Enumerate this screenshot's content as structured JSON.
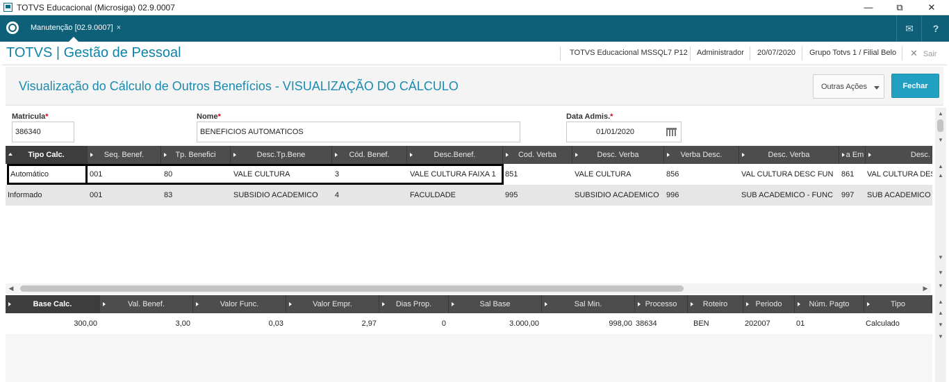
{
  "window": {
    "title": "TOTVS Educacional (Microsiga) 02.9.0007",
    "minimize": "—",
    "restore": "⧉",
    "close": "✕"
  },
  "appbar": {
    "tab_label": "Manutenção [02.9.0007]",
    "tab_close": "×",
    "mail_icon": "✉",
    "help_icon": "?"
  },
  "header": {
    "brand": "TOTVS | Gestão de Pessoal",
    "environment": "TOTVS Educacional MSSQL7 P12",
    "user": "Administrador",
    "date": "20/07/2020",
    "branch": "Grupo Totvs 1 / Filial Belo",
    "exit_label": "Sair",
    "exit_icon": "✕"
  },
  "page": {
    "title": "Visualização do Cálculo de Outros Benefícios - VISUALIZAÇÃO DO CÁLCULO",
    "other_actions_label": "Outras Ações",
    "close_label": "Fechar"
  },
  "form": {
    "matricula_label": "Matricula",
    "matricula_value": "386340",
    "nome_label": "Nome",
    "nome_value": "BENEFICIOS AUTOMATICOS",
    "data_label": "Data Admis.",
    "data_value": "01/01/2020",
    "required_mark": "*"
  },
  "grid1": {
    "columns": [
      "Tipo Calc.",
      "Seq. Benef.",
      "Tp. Benefici",
      "Desc.Tp.Bene",
      "Cód. Benef.",
      "Desc.Benef.",
      "Cod. Verba",
      "Desc. Verba",
      "Verba Desc.",
      "Desc. Verba",
      "a Em",
      "Desc."
    ],
    "rows": [
      [
        "Automático",
        "001",
        "80",
        "VALE CULTURA",
        "3",
        "VALE CULTURA FAIXA 1",
        "851",
        "VALE CULTURA",
        "856",
        "VAL CULTURA DESC FUN",
        "861",
        "VAL CULTURA DES"
      ],
      [
        "Informado",
        "001",
        "83",
        "SUBSIDIO ACADEMICO",
        "4",
        "FACULDADE",
        "995",
        "SUBSIDIO ACADEMICO",
        "996",
        "SUB ACADEMICO - FUNC",
        "997",
        "SUB ACADEMICO -"
      ]
    ]
  },
  "grid2": {
    "columns": [
      "Base Calc.",
      "Val. Benef.",
      "Valor Func.",
      "Valor Empr.",
      "Dias Prop.",
      "Sal Base",
      "Sal Min.",
      "Processo",
      "Roteiro",
      "Periodo",
      "Núm. Pagto",
      "Tipo"
    ],
    "rows": [
      [
        "300,00",
        "3,00",
        "0,03",
        "2,97",
        "0",
        "3.000,00",
        "998,00",
        "38634",
        "BEN",
        "202007",
        "01",
        "Calculado"
      ]
    ]
  },
  "colors": {
    "appbar": "#0e6079",
    "brand": "#0e83a8",
    "primary_button": "#22a0c2",
    "grid_header": "#4d4d4d"
  }
}
